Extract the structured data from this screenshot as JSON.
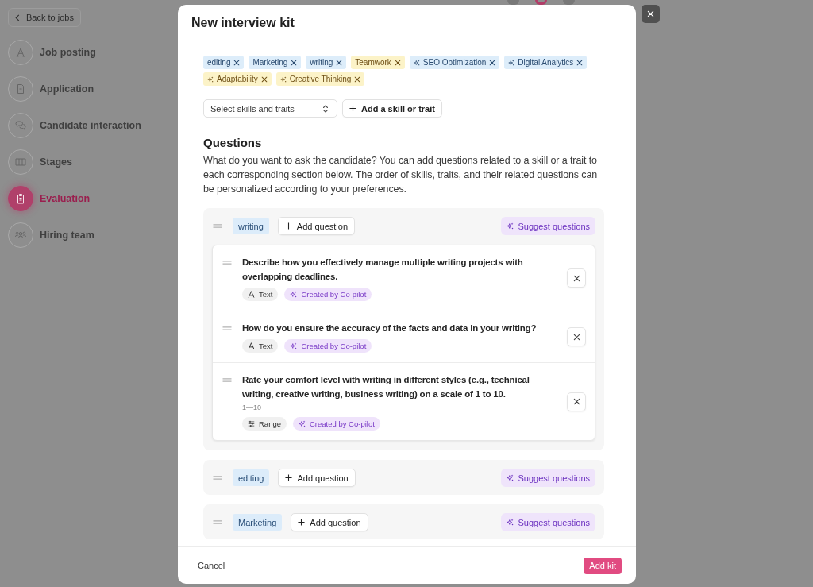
{
  "background_page": {
    "back_button": "Back to jobs",
    "steps": [
      {
        "label": "Job posting",
        "selected": false
      },
      {
        "label": "Application",
        "selected": false
      },
      {
        "label": "Candidate interaction",
        "selected": false
      },
      {
        "label": "Stages",
        "selected": false
      },
      {
        "label": "Evaluation",
        "selected": true
      },
      {
        "label": "Hiring team",
        "selected": false
      }
    ]
  },
  "modal": {
    "title": "New interview kit",
    "tags": [
      {
        "label": "editing",
        "kind": "skill",
        "suggested": false
      },
      {
        "label": "Marketing",
        "kind": "skill",
        "suggested": false
      },
      {
        "label": "writing",
        "kind": "skill",
        "suggested": false
      },
      {
        "label": "Teamwork",
        "kind": "trait",
        "suggested": false
      },
      {
        "label": "SEO Optimization",
        "kind": "skill",
        "suggested": true
      },
      {
        "label": "Digital Analytics",
        "kind": "skill",
        "suggested": true
      },
      {
        "label": "Adaptability",
        "kind": "trait",
        "suggested": true
      },
      {
        "label": "Creative Thinking",
        "kind": "trait",
        "suggested": true
      }
    ],
    "skill_select": {
      "placeholder": "Select skills and traits"
    },
    "add_skill_button": "Add a skill or trait",
    "questions_heading": "Questions",
    "questions_intro": "What do you want to ask the candidate? You can add questions related to a skill or a trait to each corresponding section below. The order of skills, traits, and their related questions can be personalized according to your preferences.",
    "groups": [
      {
        "skill": "writing",
        "add_button": "Add question",
        "suggest_button": "Suggest questions",
        "questions": [
          {
            "text": "Describe how you effectively manage multiple writing projects with overlapping deadlines.",
            "answer_type": {
              "kind": "text",
              "label": "Text"
            },
            "source": "Created by Co-pilot"
          },
          {
            "text": "How do you ensure the accuracy of the facts and data in your writing?",
            "answer_type": {
              "kind": "text",
              "label": "Text"
            },
            "source": "Created by Co-pilot"
          },
          {
            "text": "Rate your comfort level with writing in different styles (e.g., technical writing, creative writing, business writing) on a scale of 1 to 10.",
            "scale": "1—10",
            "answer_type": {
              "kind": "range",
              "label": "Range"
            },
            "source": "Created by Co-pilot"
          }
        ]
      },
      {
        "skill": "editing",
        "add_button": "Add question",
        "suggest_button": "Suggest questions"
      },
      {
        "skill": "Marketing",
        "add_button": "Add question",
        "suggest_button": "Suggest questions"
      }
    ],
    "cancel_button": "Cancel",
    "submit_button": "Add kit"
  }
}
